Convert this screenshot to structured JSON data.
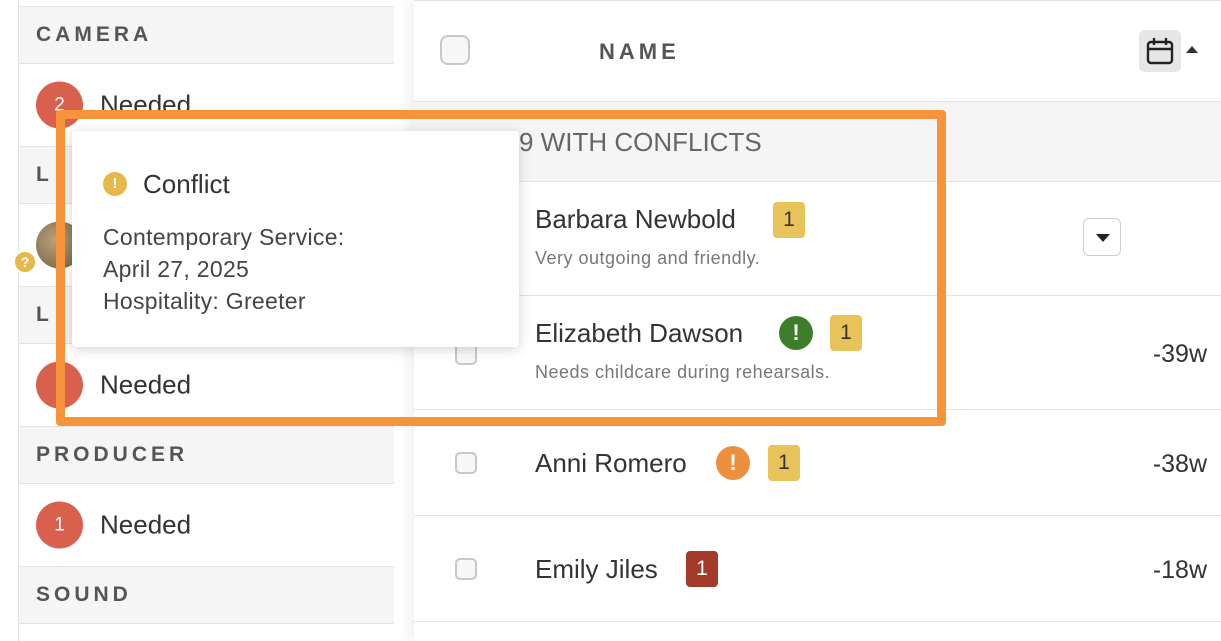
{
  "sidebar": {
    "sections": [
      {
        "title": "CAMERA",
        "count": "2",
        "label": "Needed"
      },
      {
        "title": "L",
        "label": "",
        "badge_icon": "question-icon",
        "badge_text": "?"
      },
      {
        "title": "L",
        "label": "Needed"
      },
      {
        "title": "PRODUCER",
        "count": "1",
        "label": "Needed"
      },
      {
        "title": "SOUND"
      }
    ]
  },
  "table": {
    "header": {
      "name_label": "NAME",
      "calendar_icon": "calendar-icon"
    },
    "group_label": "9 WITH CONFLICTS",
    "rows": [
      {
        "name": "Barbara Newbold",
        "badge": "1",
        "note": "Very outgoing and friendly."
      },
      {
        "name": "Elizabeth Dawson",
        "status_icon": "!",
        "badge": "1",
        "note": "Needs childcare during rehearsals.",
        "weeks": "-39w"
      },
      {
        "name": "Anni Romero",
        "status_icon": "!",
        "badge": "1",
        "weeks": "-38w"
      },
      {
        "name": "Emily Jiles",
        "badge": "1",
        "weeks": "-18w"
      }
    ]
  },
  "tooltip": {
    "icon": "!",
    "title": "Conflict",
    "lines": [
      "Contemporary Service:",
      "April 27, 2025",
      "Hospitality: Greeter"
    ]
  },
  "colors": {
    "needed_circle": "#d9604d",
    "highlight": "#f5943a",
    "badge_yellow": "#e8c35a",
    "badge_red": "#a33a2a",
    "status_green": "#3e7d2a",
    "status_orange": "#ec8f3e"
  }
}
